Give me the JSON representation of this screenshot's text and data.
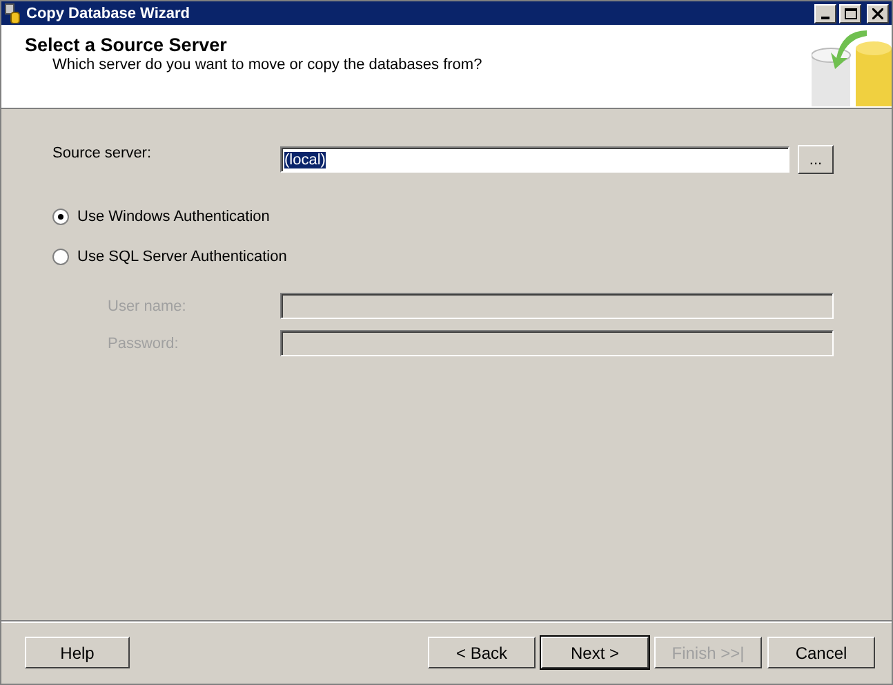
{
  "window": {
    "title": "Copy Database Wizard"
  },
  "header": {
    "title": "Select a Source Server",
    "subtitle": "Which server do you want to move or copy the databases from?"
  },
  "source_server": {
    "label": "Source server:",
    "value": "(local)",
    "browse": "..."
  },
  "authentication": [
    {
      "label": "Use Windows Authentication",
      "selected": true
    },
    {
      "label": "Use SQL Server Authentication",
      "selected": false
    }
  ],
  "credentials": [
    {
      "label": "User name:",
      "disabled": true
    },
    {
      "label": "Password:",
      "disabled": true
    }
  ],
  "buttons": [
    {
      "label": "Help",
      "disabled": false,
      "default": false
    },
    {
      "label": "< Back",
      "disabled": false,
      "default": false
    },
    {
      "label": "Next >",
      "disabled": false,
      "default": true
    },
    {
      "label": "Finish >>|",
      "disabled": true,
      "default": false
    },
    {
      "label": "Cancel",
      "disabled": false,
      "default": false
    }
  ]
}
